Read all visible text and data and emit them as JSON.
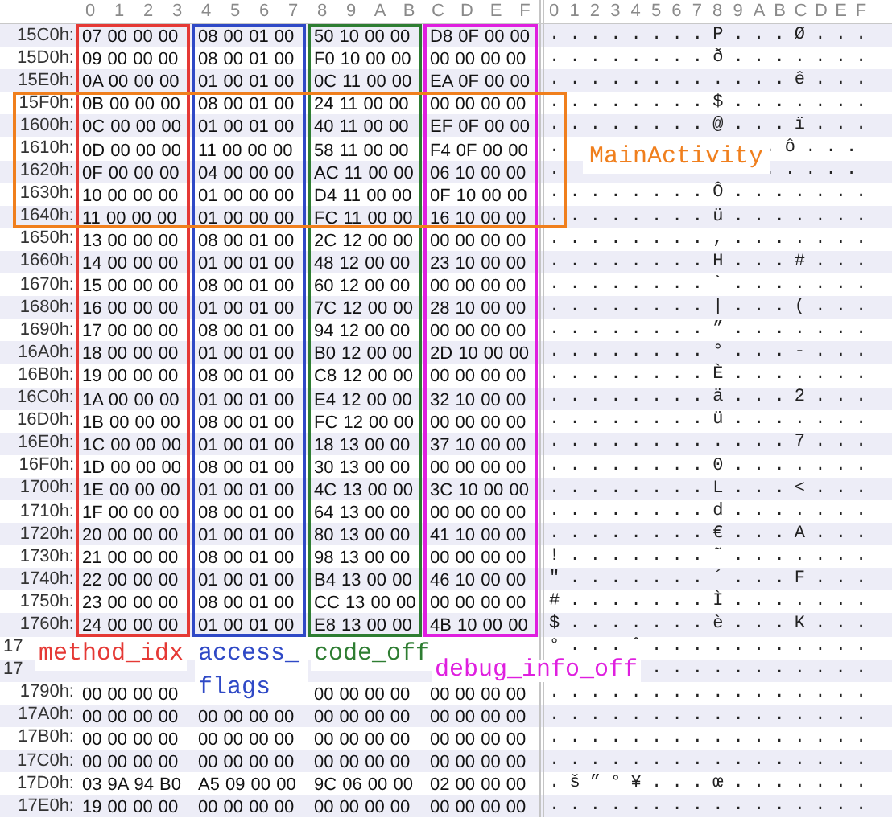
{
  "hex_columns": [
    "0",
    "1",
    "2",
    "3",
    "4",
    "5",
    "6",
    "7",
    "8",
    "9",
    "A",
    "B",
    "C",
    "D",
    "E",
    "F"
  ],
  "ascii_columns": [
    "0",
    "1",
    "2",
    "3",
    "4",
    "5",
    "6",
    "7",
    "8",
    "9",
    "A",
    "B",
    "C",
    "D",
    "E",
    "F"
  ],
  "rows": [
    {
      "kind": "full",
      "address": "15C0h:",
      "groups": [
        "07 00 00 00",
        "08 00 01 00",
        "50 10 00 00",
        "D8 0F 00 00"
      ],
      "ascii": "........P...Ø..."
    },
    {
      "kind": "full",
      "address": "15D0h:",
      "groups": [
        "09 00 00 00",
        "08 00 01 00",
        "F0 10 00 00",
        "00 00 00 00"
      ],
      "ascii": "........ð......."
    },
    {
      "kind": "full",
      "address": "15E0h:",
      "groups": [
        "0A 00 00 00",
        "01 00 01 00",
        "0C 11 00 00",
        "EA 0F 00 00"
      ],
      "ascii": "............ê..."
    },
    {
      "kind": "full",
      "address": "15F0h:",
      "groups": [
        "0B 00 00 00",
        "08 00 01 00",
        "24 11 00 00",
        "00 00 00 00"
      ],
      "ascii": "........$......."
    },
    {
      "kind": "full",
      "address": "1600h:",
      "groups": [
        "0C 00 00 00",
        "01 00 01 00",
        "40 11 00 00",
        "EF 0F 00 00"
      ],
      "ascii": "........@...ï..."
    },
    {
      "kind": "split",
      "address": "1610h:",
      "groups": [
        "0D 00 00 00",
        "11 00 00 00",
        "58 11 00 00",
        "F4 0F 00 00"
      ],
      "ascii_left": ".",
      "ascii_right": ".ô..."
    },
    {
      "kind": "split",
      "address": "1620h:",
      "groups": [
        "0F 00 00 00",
        "04 00 00 00",
        "AC 11 00 00",
        "06 10 00 00"
      ],
      "ascii_left": ".",
      "ascii_right": "....."
    },
    {
      "kind": "full",
      "address": "1630h:",
      "groups": [
        "10 00 00 00",
        "01 00 00 00",
        "D4 11 00 00",
        "0F 10 00 00"
      ],
      "ascii": "........Ô......."
    },
    {
      "kind": "full",
      "address": "1640h:",
      "groups": [
        "11 00 00 00",
        "01 00 00 00",
        "FC 11 00 00",
        "16 10 00 00"
      ],
      "ascii": "........ü......."
    },
    {
      "kind": "full",
      "address": "1650h:",
      "groups": [
        "13 00 00 00",
        "08 00 01 00",
        "2C 12 00 00",
        "00 00 00 00"
      ],
      "ascii": "........,......."
    },
    {
      "kind": "full",
      "address": "1660h:",
      "groups": [
        "14 00 00 00",
        "01 00 01 00",
        "48 12 00 00",
        "23 10 00 00"
      ],
      "ascii": "........H...#..."
    },
    {
      "kind": "full",
      "address": "1670h:",
      "groups": [
        "15 00 00 00",
        "08 00 01 00",
        "60 12 00 00",
        "00 00 00 00"
      ],
      "ascii": "........`......."
    },
    {
      "kind": "full",
      "address": "1680h:",
      "groups": [
        "16 00 00 00",
        "01 00 01 00",
        "7C 12 00 00",
        "28 10 00 00"
      ],
      "ascii": "........|...(..."
    },
    {
      "kind": "full",
      "address": "1690h:",
      "groups": [
        "17 00 00 00",
        "08 00 01 00",
        "94 12 00 00",
        "00 00 00 00"
      ],
      "ascii": "........”......."
    },
    {
      "kind": "full",
      "address": "16A0h:",
      "groups": [
        "18 00 00 00",
        "01 00 01 00",
        "B0 12 00 00",
        "2D 10 00 00"
      ],
      "ascii": "........°...-..."
    },
    {
      "kind": "full",
      "address": "16B0h:",
      "groups": [
        "19 00 00 00",
        "08 00 01 00",
        "C8 12 00 00",
        "00 00 00 00"
      ],
      "ascii": "........È......."
    },
    {
      "kind": "full",
      "address": "16C0h:",
      "groups": [
        "1A 00 00 00",
        "01 00 01 00",
        "E4 12 00 00",
        "32 10 00 00"
      ],
      "ascii": "........ä...2..."
    },
    {
      "kind": "full",
      "address": "16D0h:",
      "groups": [
        "1B 00 00 00",
        "08 00 01 00",
        "FC 12 00 00",
        "00 00 00 00"
      ],
      "ascii": "........ü......."
    },
    {
      "kind": "full",
      "address": "16E0h:",
      "groups": [
        "1C 00 00 00",
        "01 00 01 00",
        "18 13 00 00",
        "37 10 00 00"
      ],
      "ascii": "............7..."
    },
    {
      "kind": "full",
      "address": "16F0h:",
      "groups": [
        "1D 00 00 00",
        "08 00 01 00",
        "30 13 00 00",
        "00 00 00 00"
      ],
      "ascii": "........0......."
    },
    {
      "kind": "full",
      "address": "1700h:",
      "groups": [
        "1E 00 00 00",
        "01 00 01 00",
        "4C 13 00 00",
        "3C 10 00 00"
      ],
      "ascii": "........L...<..."
    },
    {
      "kind": "full",
      "address": "1710h:",
      "groups": [
        "1F 00 00 00",
        "08 00 01 00",
        "64 13 00 00",
        "00 00 00 00"
      ],
      "ascii": "........d......."
    },
    {
      "kind": "full",
      "address": "1720h:",
      "groups": [
        "20 00 00 00",
        "01 00 01 00",
        "80 13 00 00",
        "41 10 00 00"
      ],
      "ascii": "........€...A..."
    },
    {
      "kind": "full",
      "address": "1730h:",
      "groups": [
        "21 00 00 00",
        "08 00 01 00",
        "98 13 00 00",
        "00 00 00 00"
      ],
      "ascii": "!.......˜......."
    },
    {
      "kind": "full",
      "address": "1740h:",
      "groups": [
        "22 00 00 00",
        "01 00 01 00",
        "B4 13 00 00",
        "46 10 00 00"
      ],
      "ascii": "\".......´...F..."
    },
    {
      "kind": "full",
      "address": "1750h:",
      "groups": [
        "23 00 00 00",
        "08 00 01 00",
        "CC 13 00 00",
        "00 00 00 00"
      ],
      "ascii": "#.......Ì......."
    },
    {
      "kind": "full",
      "address": "1760h:",
      "groups": [
        "24 00 00 00",
        "01 00 01 00",
        "E8 13 00 00",
        "4B 10 00 00"
      ],
      "ascii": "$.......è...K..."
    },
    {
      "kind": "band",
      "address": "17",
      "ascii": "°...ˆ..........."
    },
    {
      "kind": "band",
      "address": "17",
      "ascii": "..........."
    },
    {
      "kind": "gap",
      "address": "1790h:",
      "groups": [
        "00 00 00 00",
        "00 00 00 00",
        "00 00 00 00"
      ],
      "ascii": "................"
    },
    {
      "kind": "full",
      "address": "17A0h:",
      "groups": [
        "00 00 00 00",
        "00 00 00 00",
        "00 00 00 00",
        "00 00 00 00"
      ],
      "ascii": "................"
    },
    {
      "kind": "full",
      "address": "17B0h:",
      "groups": [
        "00 00 00 00",
        "00 00 00 00",
        "00 00 00 00",
        "00 00 00 00"
      ],
      "ascii": "................"
    },
    {
      "kind": "full",
      "address": "17C0h:",
      "groups": [
        "00 00 00 00",
        "00 00 00 00",
        "00 00 00 00",
        "00 00 00 00"
      ],
      "ascii": "................"
    },
    {
      "kind": "full",
      "address": "17D0h:",
      "groups": [
        "03 9A 94 B0",
        "A5 09 00 00",
        "9C 06 00 00",
        "02 00 00 00"
      ],
      "ascii": ".š”°¥...œ......."
    },
    {
      "kind": "full",
      "address": "17E0h:",
      "groups": [
        "19 00 00 00",
        "00 00 00 00",
        "00 00 00 00",
        "00 00 00 00"
      ],
      "ascii": "................"
    }
  ],
  "annotations": [
    {
      "label": "method_idx",
      "color": "#e53935"
    },
    {
      "label": "access_ flags",
      "color": "#2f49c6"
    },
    {
      "label": "code_off",
      "color": "#2e7d32"
    },
    {
      "label": "debug_info_off",
      "color": "#df1fdf"
    }
  ],
  "callout": {
    "label": "MainActivity",
    "color": "#f07f1d"
  }
}
